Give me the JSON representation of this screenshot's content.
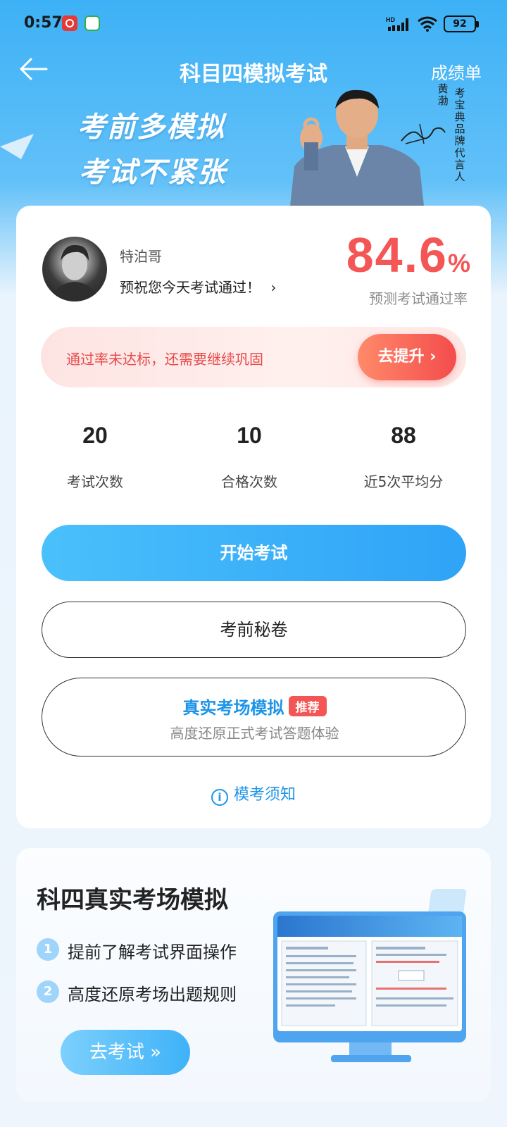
{
  "status_bar": {
    "time": "0:57",
    "battery": "92",
    "network": "HD"
  },
  "header": {
    "title": "科目四模拟考试",
    "report": "成绩单"
  },
  "banner": {
    "line1": "考前多模拟",
    "line2": "考试不紧张",
    "spokesman_name": "黄渤",
    "spokesman_caption": "考宝典品牌代言人"
  },
  "profile": {
    "username": "特泊哥",
    "wish": "预祝您今天考试通过！",
    "pass_rate_value": "84.6",
    "pass_rate_unit": "%",
    "pass_rate_label": "预测考试通过率"
  },
  "warning": {
    "text": "通过率未达标，还需要继续巩固",
    "button": "去提升"
  },
  "stats": [
    {
      "value": "20",
      "label": "考试次数"
    },
    {
      "value": "10",
      "label": "合格次数"
    },
    {
      "value": "88",
      "label": "近5次平均分"
    }
  ],
  "buttons": {
    "start": "开始考试",
    "secret": "考前秘卷",
    "real_title": "真实考场模拟",
    "real_badge": "推荐",
    "real_sub": "高度还原正式考试答题体验"
  },
  "notice": "模考须知",
  "bottom": {
    "title": "科四真实考场模拟",
    "features": [
      {
        "num": "1",
        "text": "提前了解考试界面操作"
      },
      {
        "num": "2",
        "text": "高度还原考场出题规则"
      }
    ],
    "go_exam": "去考试"
  },
  "colors": {
    "primary": "#2fa3f7",
    "accent_red": "#f45656"
  }
}
